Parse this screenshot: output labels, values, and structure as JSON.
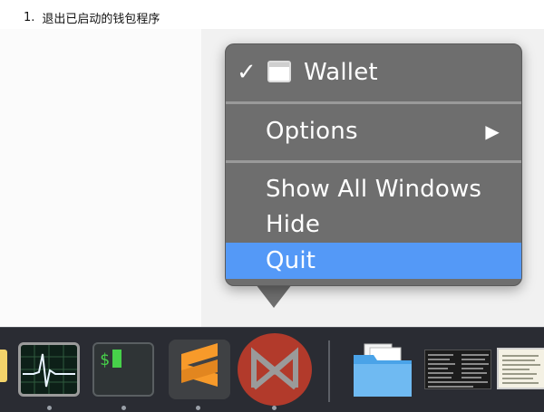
{
  "instruction": {
    "number": "1.",
    "text": "退出已启动的钱包程序"
  },
  "menu": {
    "wallet": {
      "check": "✓",
      "label": "Wallet",
      "icon": "window-icon"
    },
    "options": {
      "label": "Options",
      "arrow": "▶"
    },
    "show_all_windows": {
      "label": "Show All Windows"
    },
    "hide": {
      "label": "Hide"
    },
    "quit": {
      "label": "Quit",
      "highlighted": true
    },
    "highlight_color": "#5499f7",
    "background_color": "#6e6e6e"
  },
  "dock": {
    "apps": [
      {
        "name": "partial-app",
        "running": false
      },
      {
        "name": "activity-monitor",
        "running": true
      },
      {
        "name": "terminal",
        "running": true,
        "prompt": "$"
      },
      {
        "name": "sublime-text",
        "running": true
      },
      {
        "name": "wallet-app",
        "running": true
      },
      {
        "name": "folder",
        "running": false
      },
      {
        "name": "window-thumbnail-1",
        "running": false
      },
      {
        "name": "window-thumbnail-2",
        "running": false
      }
    ],
    "background_color": "#2a2c33"
  }
}
